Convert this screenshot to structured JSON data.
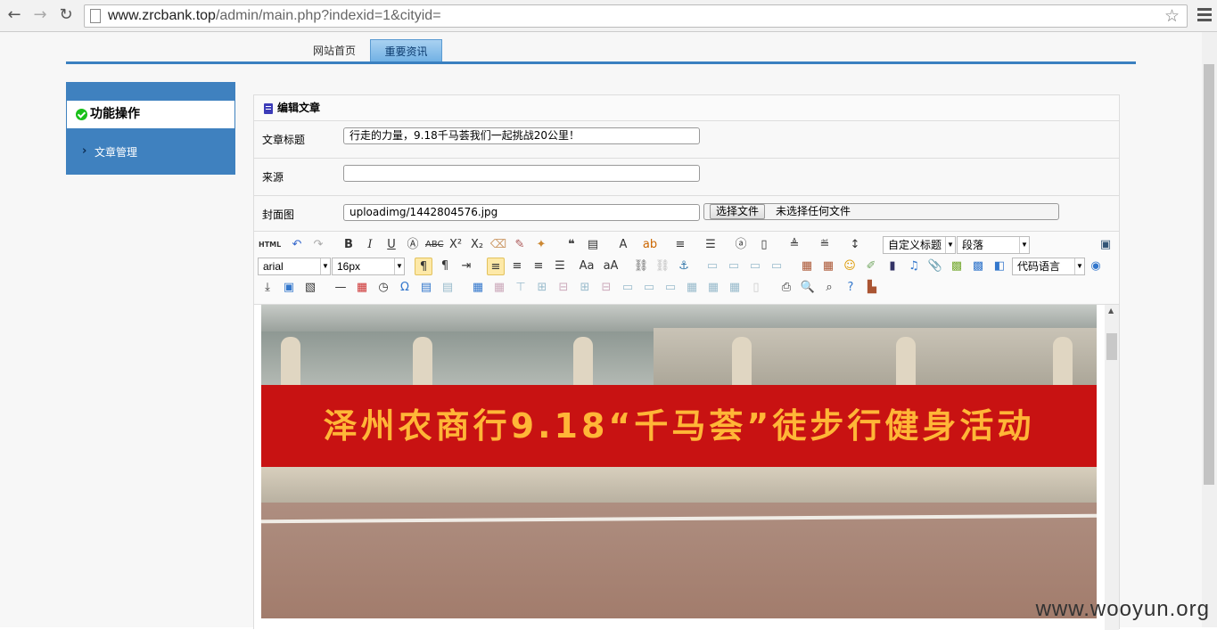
{
  "browser": {
    "url_host": "www.zrcbank.top",
    "url_path": "/admin/main.php?indexid=1&cityid="
  },
  "topnav": {
    "tabs": [
      {
        "label": "网站首页"
      },
      {
        "label": "重要资讯"
      }
    ]
  },
  "sidebar": {
    "heading": "功能操作",
    "items": [
      {
        "label": "文章管理"
      }
    ]
  },
  "panel": {
    "title": "编辑文章",
    "fields": {
      "title_label": "文章标题",
      "title_value": "行走的力量，9.18千马荟我们一起挑战20公里！",
      "source_label": "来源",
      "source_value": "",
      "cover_label": "封面图",
      "cover_value": "uploadimg/1442804576.jpg",
      "file_button": "选择文件",
      "file_status": "未选择任何文件"
    }
  },
  "toolbar": {
    "html_label": "HTML",
    "font_family": "arial",
    "font_size": "16px",
    "custom_heading": "自定义标题",
    "paragraph": "段落",
    "code_language": "代码语言"
  },
  "editor": {
    "banner_text": "泽州农商行9.18“千马荟”徒步行健身活动"
  },
  "watermark": "www.wooyun.org"
}
